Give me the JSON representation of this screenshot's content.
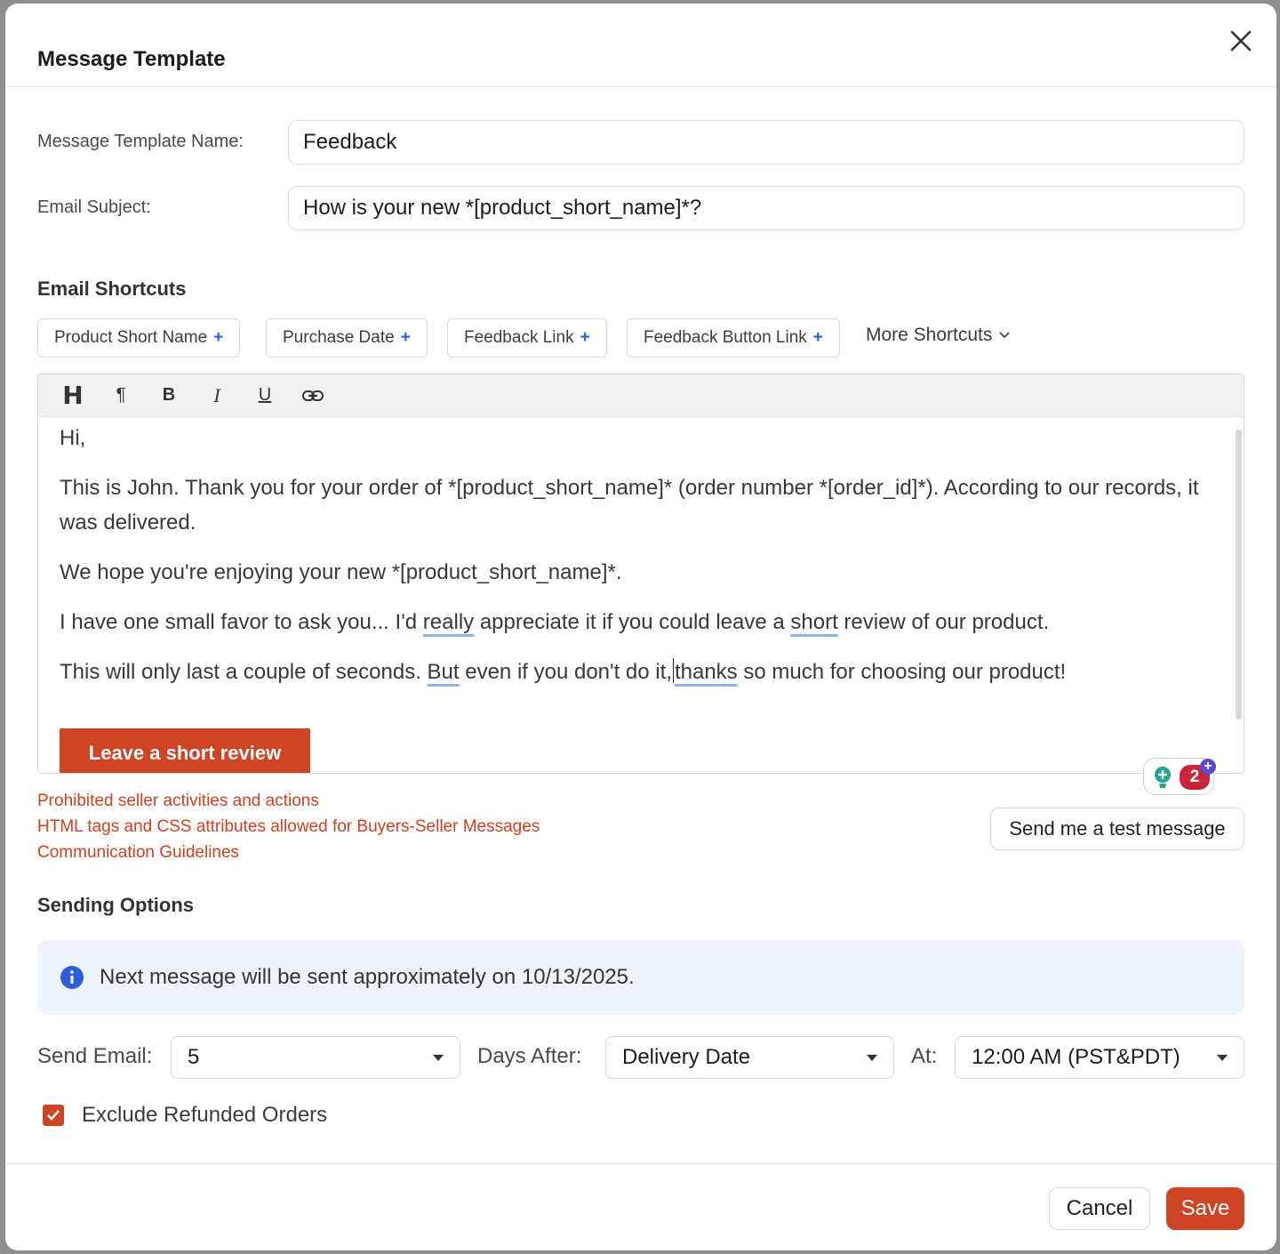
{
  "modal": {
    "title": "Message Template",
    "close_icon": "close-icon"
  },
  "form": {
    "name_label": "Message Template Name:",
    "name_value": "Feedback",
    "subject_label": "Email Subject:",
    "subject_value": "How is your new *[product_short_name]*?"
  },
  "shortcuts": {
    "title": "Email Shortcuts",
    "chips": [
      "Product Short Name",
      "Purchase Date",
      "Feedback Link",
      "Feedback Button Link"
    ],
    "plus": "+",
    "more_label": "More Shortcuts"
  },
  "editor": {
    "toolbar": {
      "heading": "H",
      "paragraph": "¶",
      "bold": "B",
      "italic": "I",
      "underline": "U",
      "link_icon": "link-icon"
    },
    "greeting": "Hi,",
    "p1": "This is John. Thank you for your order of *[product_short_name]* (order number *[order_id]*). According to our records, it was delivered.",
    "p2": "We hope you're enjoying your new *[product_short_name]*.",
    "p3_a": "I have one small favor to ask you... I'd ",
    "p3_really": "really",
    "p3_b": " appreciate it if you could leave a ",
    "p3_short": "short",
    "p3_c": " review of our product.",
    "p4_a": "This will only last a couple of seconds. ",
    "p4_but": "But",
    "p4_b": " even if you don't do it,",
    "p4_c": " ",
    "p4_thanks": "thanks",
    "p4_d": " so much for choosing our product!",
    "review_button": "Leave a short review"
  },
  "extension": {
    "icon": "lightbulb-icon",
    "badge": "2",
    "plus": "+"
  },
  "links": [
    "Prohibited seller activities and actions",
    "HTML tags and CSS attributes allowed for Buyers-Seller Messages",
    "Communication Guidelines"
  ],
  "test_button": "Send me a test message",
  "sending": {
    "title": "Sending Options",
    "info_icon": "info-icon",
    "info_text": "Next message will be sent approximately on 10/13/2025.",
    "send_email_label": "Send Email:",
    "send_email_value": "5",
    "days_after_label": "Days After:",
    "days_after_value": "Delivery Date",
    "at_label": "At:",
    "at_value": "12:00 AM (PST&PDT)",
    "exclude_label": "Exclude Refunded Orders",
    "exclude_checked": true
  },
  "footer": {
    "cancel": "Cancel",
    "save": "Save"
  },
  "colors": {
    "accent": "#cf4424",
    "link": "#d2401f",
    "info_bg": "#eef3fd",
    "info_icon": "#2b5fd9"
  }
}
